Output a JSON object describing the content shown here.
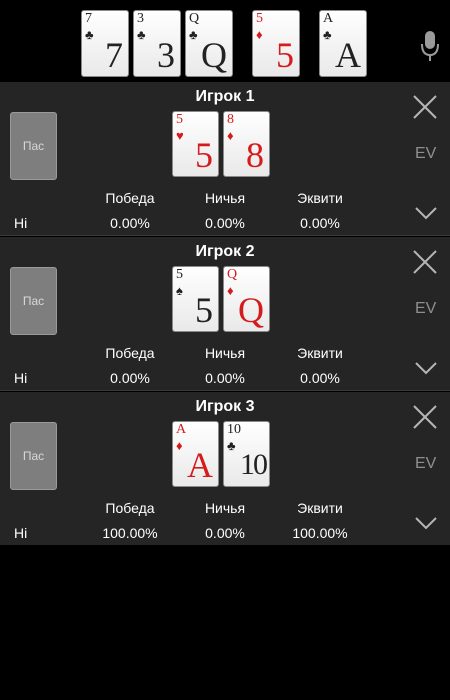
{
  "board": {
    "cards": [
      {
        "rank": "7",
        "suit": "♣",
        "color": "black"
      },
      {
        "rank": "3",
        "suit": "♣",
        "color": "black"
      },
      {
        "rank": "Q",
        "suit": "♣",
        "color": "black"
      },
      {
        "rank": "5",
        "suit": "♦",
        "color": "red"
      },
      {
        "rank": "A",
        "suit": "♣",
        "color": "black"
      }
    ],
    "mic_icon": "microphone-icon"
  },
  "labels": {
    "pass": "Пас",
    "ev": "EV",
    "win": "Победа",
    "tie": "Ничья",
    "equity": "Эквити",
    "hi": "Hi"
  },
  "players": [
    {
      "title": "Игрок 1",
      "cards": [
        {
          "rank": "5",
          "suit": "♥",
          "color": "red"
        },
        {
          "rank": "8",
          "suit": "♦",
          "color": "red"
        }
      ],
      "win": "0.00%",
      "tie": "0.00%",
      "equity": "0.00%"
    },
    {
      "title": "Игрок 2",
      "cards": [
        {
          "rank": "5",
          "suit": "♠",
          "color": "black"
        },
        {
          "rank": "Q",
          "suit": "♦",
          "color": "red"
        }
      ],
      "win": "0.00%",
      "tie": "0.00%",
      "equity": "0.00%"
    },
    {
      "title": "Игрок 3",
      "cards": [
        {
          "rank": "A",
          "suit": "♦",
          "color": "red"
        },
        {
          "rank": "10",
          "suit": "♣",
          "color": "black"
        }
      ],
      "win": "100.00%",
      "tie": "0.00%",
      "equity": "100.00%"
    }
  ]
}
